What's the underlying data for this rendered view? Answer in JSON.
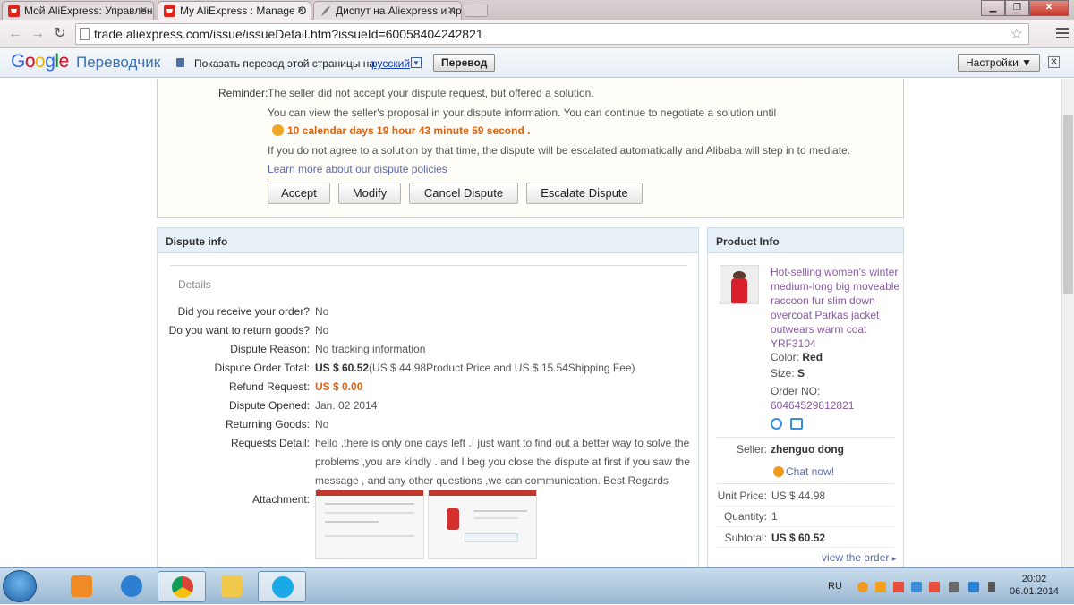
{
  "browser": {
    "tabs": [
      {
        "label": "Мой AliExpress: Управлен",
        "active": false
      },
      {
        "label": "My AliExpress : Manage O",
        "active": true
      },
      {
        "label": "Диспут на Aliexpress и пр",
        "active": false
      }
    ],
    "url": "trade.aliexpress.com/issue/issueDetail.htm?issueId=60058404242821"
  },
  "translate_bar": {
    "logo_google": "Google",
    "logo_product": "Переводчик",
    "prompt": "Показать перевод этой страницы на",
    "language": "русский",
    "translate_button": "Перевод",
    "settings_button": "Настройки ▼"
  },
  "reminder": {
    "label": "Reminder:",
    "line1": "The seller did not accept your dispute request, but offered a solution.",
    "line2": "You can view the seller's proposal in your dispute information. You can continue to negotiate a solution until",
    "countdown": "10 calendar days 19 hour 43 minute 59 second .",
    "line4": "If you do not agree to a solution by that time, the dispute will be escalated automatically and Alibaba will step in to mediate.",
    "learn_more": "Learn more about our dispute policies",
    "buttons": {
      "accept": "Accept",
      "modify": "Modify",
      "cancel": "Cancel Dispute",
      "escalate": "Escalate Dispute"
    }
  },
  "dispute_info": {
    "header": "Dispute info",
    "details_title": "Details",
    "rows": [
      {
        "label": "Did you receive your order?",
        "value": "No"
      },
      {
        "label": "Do you want to return goods?",
        "value": "No"
      },
      {
        "label": "Dispute Reason:",
        "value": "No tracking information"
      },
      {
        "label": "Dispute Order Total:",
        "value_bold": "US $ 60.52",
        "value": "(US $ 44.98Product Price and US $ 15.54Shipping Fee)"
      },
      {
        "label": "Refund Request:",
        "value": "US $ 0.00"
      },
      {
        "label": "Dispute Opened:",
        "value": "Jan. 02 2014"
      },
      {
        "label": "Returning Goods:",
        "value": "No"
      }
    ],
    "requests_label": "Requests Detail:",
    "requests_lines": [
      "hello ,there is only one days left .I just want to find out a better way to solve the",
      "problems ,you are kindly . and I beg you close the dispute at first if you saw the",
      "message , and any other questions ,we can communication. Best Regards Junrior"
    ],
    "attachment_label": "Attachment:"
  },
  "product_info": {
    "header": "Product Info",
    "title_lines": [
      "Hot-selling women's winter",
      "medium-long big moveable",
      "raccoon fur slim down",
      "overcoat Parkas jacket",
      "outwears warm coat",
      "YRF3104"
    ],
    "color_label": "Color:",
    "color_value": "Red",
    "size_label": "Size:",
    "size_value": "S",
    "order_no_label": "Order NO:",
    "order_no": "60464529812821",
    "seller_label": "Seller:",
    "seller": "zhenguo dong",
    "chat": "Chat now!",
    "unit_price_label": "Unit Price:",
    "unit_price": "US $ 44.98",
    "quantity_label": "Quantity:",
    "quantity": "1",
    "subtotal_label": "Subtotal:",
    "subtotal": "US $ 60.52",
    "view_order": "view the order"
  },
  "taskbar": {
    "lang": "RU",
    "time": "20:02",
    "date": "06.01.2014"
  },
  "colors": {
    "accent_orange": "#e4600b",
    "link_blue": "#5b6ab0",
    "product_purple": "#8a5aa0"
  }
}
